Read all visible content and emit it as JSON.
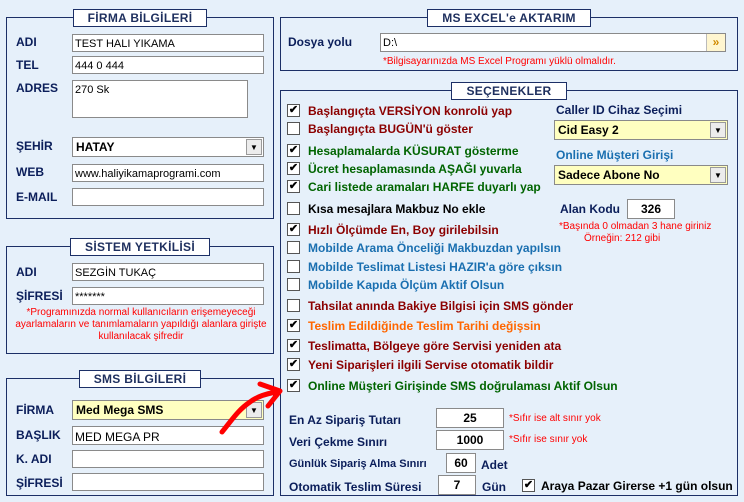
{
  "firma": {
    "title": "FİRMA BİLGİLERİ",
    "adi_label": "ADI",
    "adi_value": "TEST HALI YIKAMA",
    "tel_label": "TEL",
    "tel_value": "444 0 444",
    "adres_label": "ADRES",
    "adres_value": "270 Sk",
    "sehir_label": "ŞEHİR",
    "sehir_value": "HATAY",
    "web_label": "WEB",
    "web_value": "www.haliyikamaprogrami.com",
    "email_label": "E-MAIL",
    "email_value": ""
  },
  "sistem": {
    "title": "SİSTEM YETKİLİSİ",
    "adi_label": "ADI",
    "adi_value": "SEZGİN TUKAÇ",
    "sifre_label": "ŞİFRESİ",
    "sifre_value": "*******",
    "note": "*Programınızda normal kullanıcıların erişemeyeceği ayarlamaların ve tanımlamaların yapıldığı alanlara girişte kullanılacak şifredir"
  },
  "sms": {
    "title": "SMS BİLGİLERİ",
    "firma_label": "FİRMA",
    "firma_value": "Med Mega SMS",
    "baslik_label": "BAŞLIK",
    "baslik_value": "MED MEGA PR",
    "kadi_label": "K. ADI",
    "kadi_value": "",
    "sifre_label": "ŞİFRESİ",
    "sifre_value": ""
  },
  "excel": {
    "title": "MS EXCEL'e AKTARIM",
    "dosya_label": "Dosya yolu",
    "dosya_value": "D:\\",
    "warning": "*Bilgisayarınızda MS Excel Programı yüklü olmalıdır."
  },
  "secenekler": {
    "title": "SEÇENEKLER",
    "options": [
      {
        "label": "Başlangıçta VERSİYON konrolü yap",
        "checked": true,
        "color": "#8b0000"
      },
      {
        "label": "Başlangıçta BUGÜN'ü göster",
        "checked": false,
        "color": "#8b0000"
      },
      {
        "label": "Hesaplamalarda KÜSURAT gösterme",
        "checked": true,
        "color": "#006400"
      },
      {
        "label": "Ücret hesaplamasında AŞAĞI yuvarla",
        "checked": true,
        "color": "#006400"
      },
      {
        "label": "Cari listede aramaları HARFE duyarlı yap",
        "checked": true,
        "color": "#006400"
      },
      {
        "label": "Kısa mesajlara Makbuz No ekle",
        "checked": false,
        "color": "#000000"
      },
      {
        "label": "Hızlı Ölçümde En, Boy girilebilsin",
        "checked": true,
        "color": "#8b0000"
      },
      {
        "label": "Mobilde Arama Önceliği Makbuzdan yapılsın",
        "checked": false,
        "color": "#1a6fb0"
      },
      {
        "label": "Mobilde Teslimat Listesi HAZIR'a göre çıksın",
        "checked": false,
        "color": "#1a6fb0"
      },
      {
        "label": "Mobilde Kapıda Ölçüm Aktif Olsun",
        "checked": false,
        "color": "#1a6fb0"
      },
      {
        "label": "Tahsilat anında Bakiye Bilgisi için SMS gönder",
        "checked": false,
        "color": "#8b0000"
      },
      {
        "label": "Teslim Edildiğinde Teslim Tarihi değişsin",
        "checked": true,
        "color": "#ff6600"
      },
      {
        "label": "Teslimatta, Bölgeye göre Servisi yeniden ata",
        "checked": true,
        "color": "#8b0000"
      },
      {
        "label": "Yeni Siparişleri ilgili Servise otomatik bildir",
        "checked": true,
        "color": "#8b0000"
      },
      {
        "label": "Online Müşteri Girişinde SMS doğrulaması Aktif Olsun",
        "checked": true,
        "color": "#006400"
      }
    ],
    "callerid_label": "Caller ID Cihaz Seçimi",
    "callerid_value": "Cid Easy 2",
    "online_label": "Online Müşteri Girişi",
    "online_value": "Sadece Abone No",
    "alan_kodu_label": "Alan Kodu",
    "alan_kodu_value": "326",
    "alan_kodu_note1": "*Başında 0 olmadan 3 hane giriniz",
    "alan_kodu_note2": "Örneğin:  212  gibi",
    "min_siparis_label": "En Az Sipariş Tutarı",
    "min_siparis_value": "25",
    "min_siparis_note": "*Sıfır ise alt sınır yok",
    "veri_label": "Veri Çekme Sınırı",
    "veri_value": "1000",
    "veri_note": "*Sıfır ise sınır yok",
    "gunluk_label": "Günlük Sipariş Alma Sınırı",
    "gunluk_value": "60",
    "gunluk_unit": "Adet",
    "teslim_label": "Otomatik Teslim Süresi",
    "teslim_value": "7",
    "teslim_unit": "Gün",
    "pazar_label": "Araya Pazar Girerse +1 gün olsun",
    "pazar_checked": true
  },
  "colors": {
    "panel_border": "#1c2f66",
    "background": "#e6f0fa",
    "annotation": "#ff0000",
    "highlight_field": "#ffffc0"
  }
}
